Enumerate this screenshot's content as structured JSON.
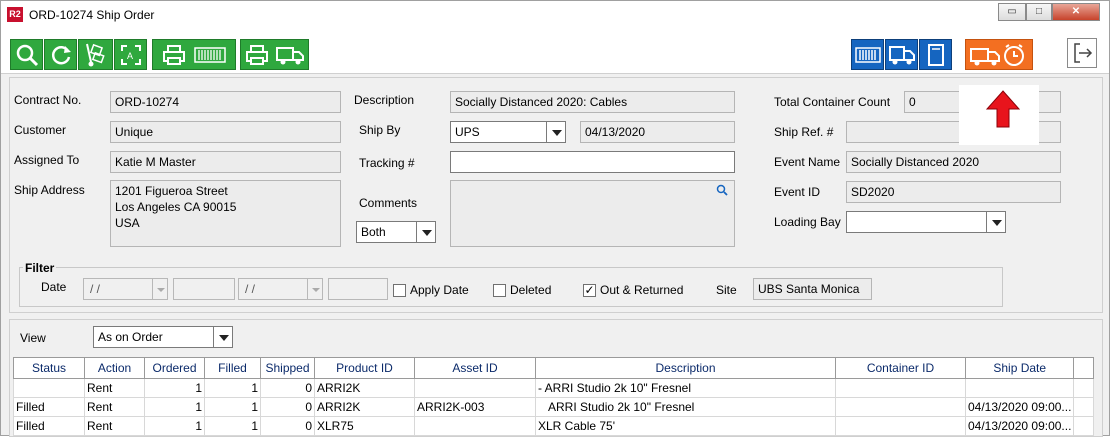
{
  "window": {
    "badge": "R2",
    "title": "ORD-10274 Ship Order",
    "controls": {
      "minimize": "▭",
      "maximize": "□",
      "close": "✕"
    }
  },
  "toolbar": {
    "left_buttons": [
      "search-icon",
      "refresh-icon",
      "hand-truck-icon",
      "fit-screen-icon",
      "print-icon",
      "print-barcode-icon",
      "print-truck-icon"
    ],
    "right_buttons": [
      "barcode-icon",
      "truck-schedule-icon",
      "book-icon",
      "truck-alarm-icon"
    ],
    "colors": {
      "green": "#2fa83e",
      "blue": "#1565c0",
      "orange": "#f36f21",
      "arrow": "#e8141c"
    }
  },
  "form": {
    "contract_no_label": "Contract No.",
    "contract_no": "ORD-10274",
    "customer_label": "Customer",
    "customer": "Unique",
    "assigned_to_label": "Assigned To",
    "assigned_to": "Katie M Master",
    "ship_address_label": "Ship Address",
    "ship_address": "1201 Figueroa Street\nLos Angeles CA 90015\nUSA",
    "description_label": "Description",
    "description": "Socially Distanced 2020: Cables",
    "ship_by_label": "Ship By",
    "ship_by": "UPS",
    "ship_date": "04/13/2020",
    "tracking_label": "Tracking #",
    "tracking": "",
    "comments_label": "Comments",
    "comments_filter": "Both",
    "total_container_label": "Total Container Count",
    "total_container": "0",
    "ship_ref_label": "Ship Ref. #",
    "ship_ref": "",
    "event_name_label": "Event Name",
    "event_name": "Socially Distanced 2020",
    "event_id_label": "Event ID",
    "event_id": "SD2020",
    "loading_bay_label": "Loading Bay",
    "loading_bay": ""
  },
  "filter": {
    "title": "Filter",
    "date_label": "Date",
    "date_from": "/ /",
    "date_to": "/ /",
    "apply_date_label": "Apply Date",
    "apply_date_checked": false,
    "deleted_label": "Deleted",
    "deleted_checked": false,
    "out_returned_label": "Out & Returned",
    "out_returned_checked": true,
    "out_returned_mark": "✓",
    "site_label": "Site",
    "site": "UBS Santa Monica"
  },
  "view": {
    "label": "View",
    "value": "As on Order"
  },
  "grid": {
    "columns": [
      "Status",
      "Action",
      "Ordered",
      "Filled",
      "Shipped",
      "Product ID",
      "Asset ID",
      "Description",
      "Container ID",
      "Ship Date"
    ],
    "rows": [
      [
        "",
        "Rent",
        "1",
        "1",
        "0",
        "ARRI2K",
        "",
        "- ARRI Studio 2k 10\" Fresnel",
        "",
        ""
      ],
      [
        "Filled",
        "Rent",
        "1",
        "1",
        "0",
        "ARRI2K",
        "ARRI2K-003",
        "ARRI Studio 2k 10\" Fresnel",
        "",
        "04/13/2020 09:00..."
      ],
      [
        "Filled",
        "Rent",
        "1",
        "1",
        "0",
        "XLR75",
        "",
        "XLR Cable 75'",
        "",
        "04/13/2020 09:00..."
      ]
    ]
  }
}
